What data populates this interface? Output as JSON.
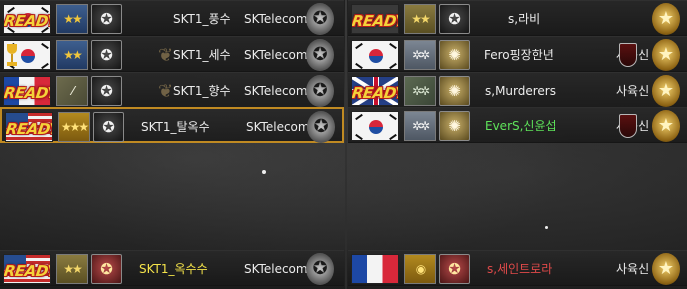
{
  "ui": {
    "ready_label": "READY"
  },
  "icons": {
    "trophy": "trophy-icon",
    "rank_stars": "rank-stars-icon",
    "badge": "badge-icon",
    "clan": "clan-emblem-icon",
    "shield": "shield-icon"
  },
  "colors": {
    "ready_text": "#f4d23a",
    "ready_outline": "#b61a1a",
    "selected_border": "#c08a22",
    "highlight_yellow": "#f4e34a",
    "highlight_green": "#5ee35a",
    "highlight_red": "#e04a4a"
  },
  "team_a": {
    "players": [
      {
        "name": "SKT1_풍수",
        "clan": "SKTelecom",
        "ready": true
      },
      {
        "name": "SKT1_세수",
        "clan": "SKTelecom",
        "ready": false
      },
      {
        "name": "SKT1_향수",
        "clan": "SKTelecom",
        "ready": true
      },
      {
        "name": "SKT1_탈옥수",
        "clan": "SKTelecom",
        "ready": true
      },
      {
        "name": "SKT1_옥수수",
        "clan": "SKTelecom",
        "ready": true
      }
    ]
  },
  "team_b": {
    "players": [
      {
        "name": "s,라비",
        "clan": "",
        "ready": true
      },
      {
        "name": "Fero핑장한년",
        "clan": "사육신",
        "ready": false
      },
      {
        "name": "s,Murderers",
        "clan": "사육신",
        "ready": true
      },
      {
        "name": "EverS,신윤섭",
        "clan": "사육신",
        "ready": false
      },
      {
        "name": "s,세인트로라",
        "clan": "사육신",
        "ready": false
      }
    ]
  }
}
